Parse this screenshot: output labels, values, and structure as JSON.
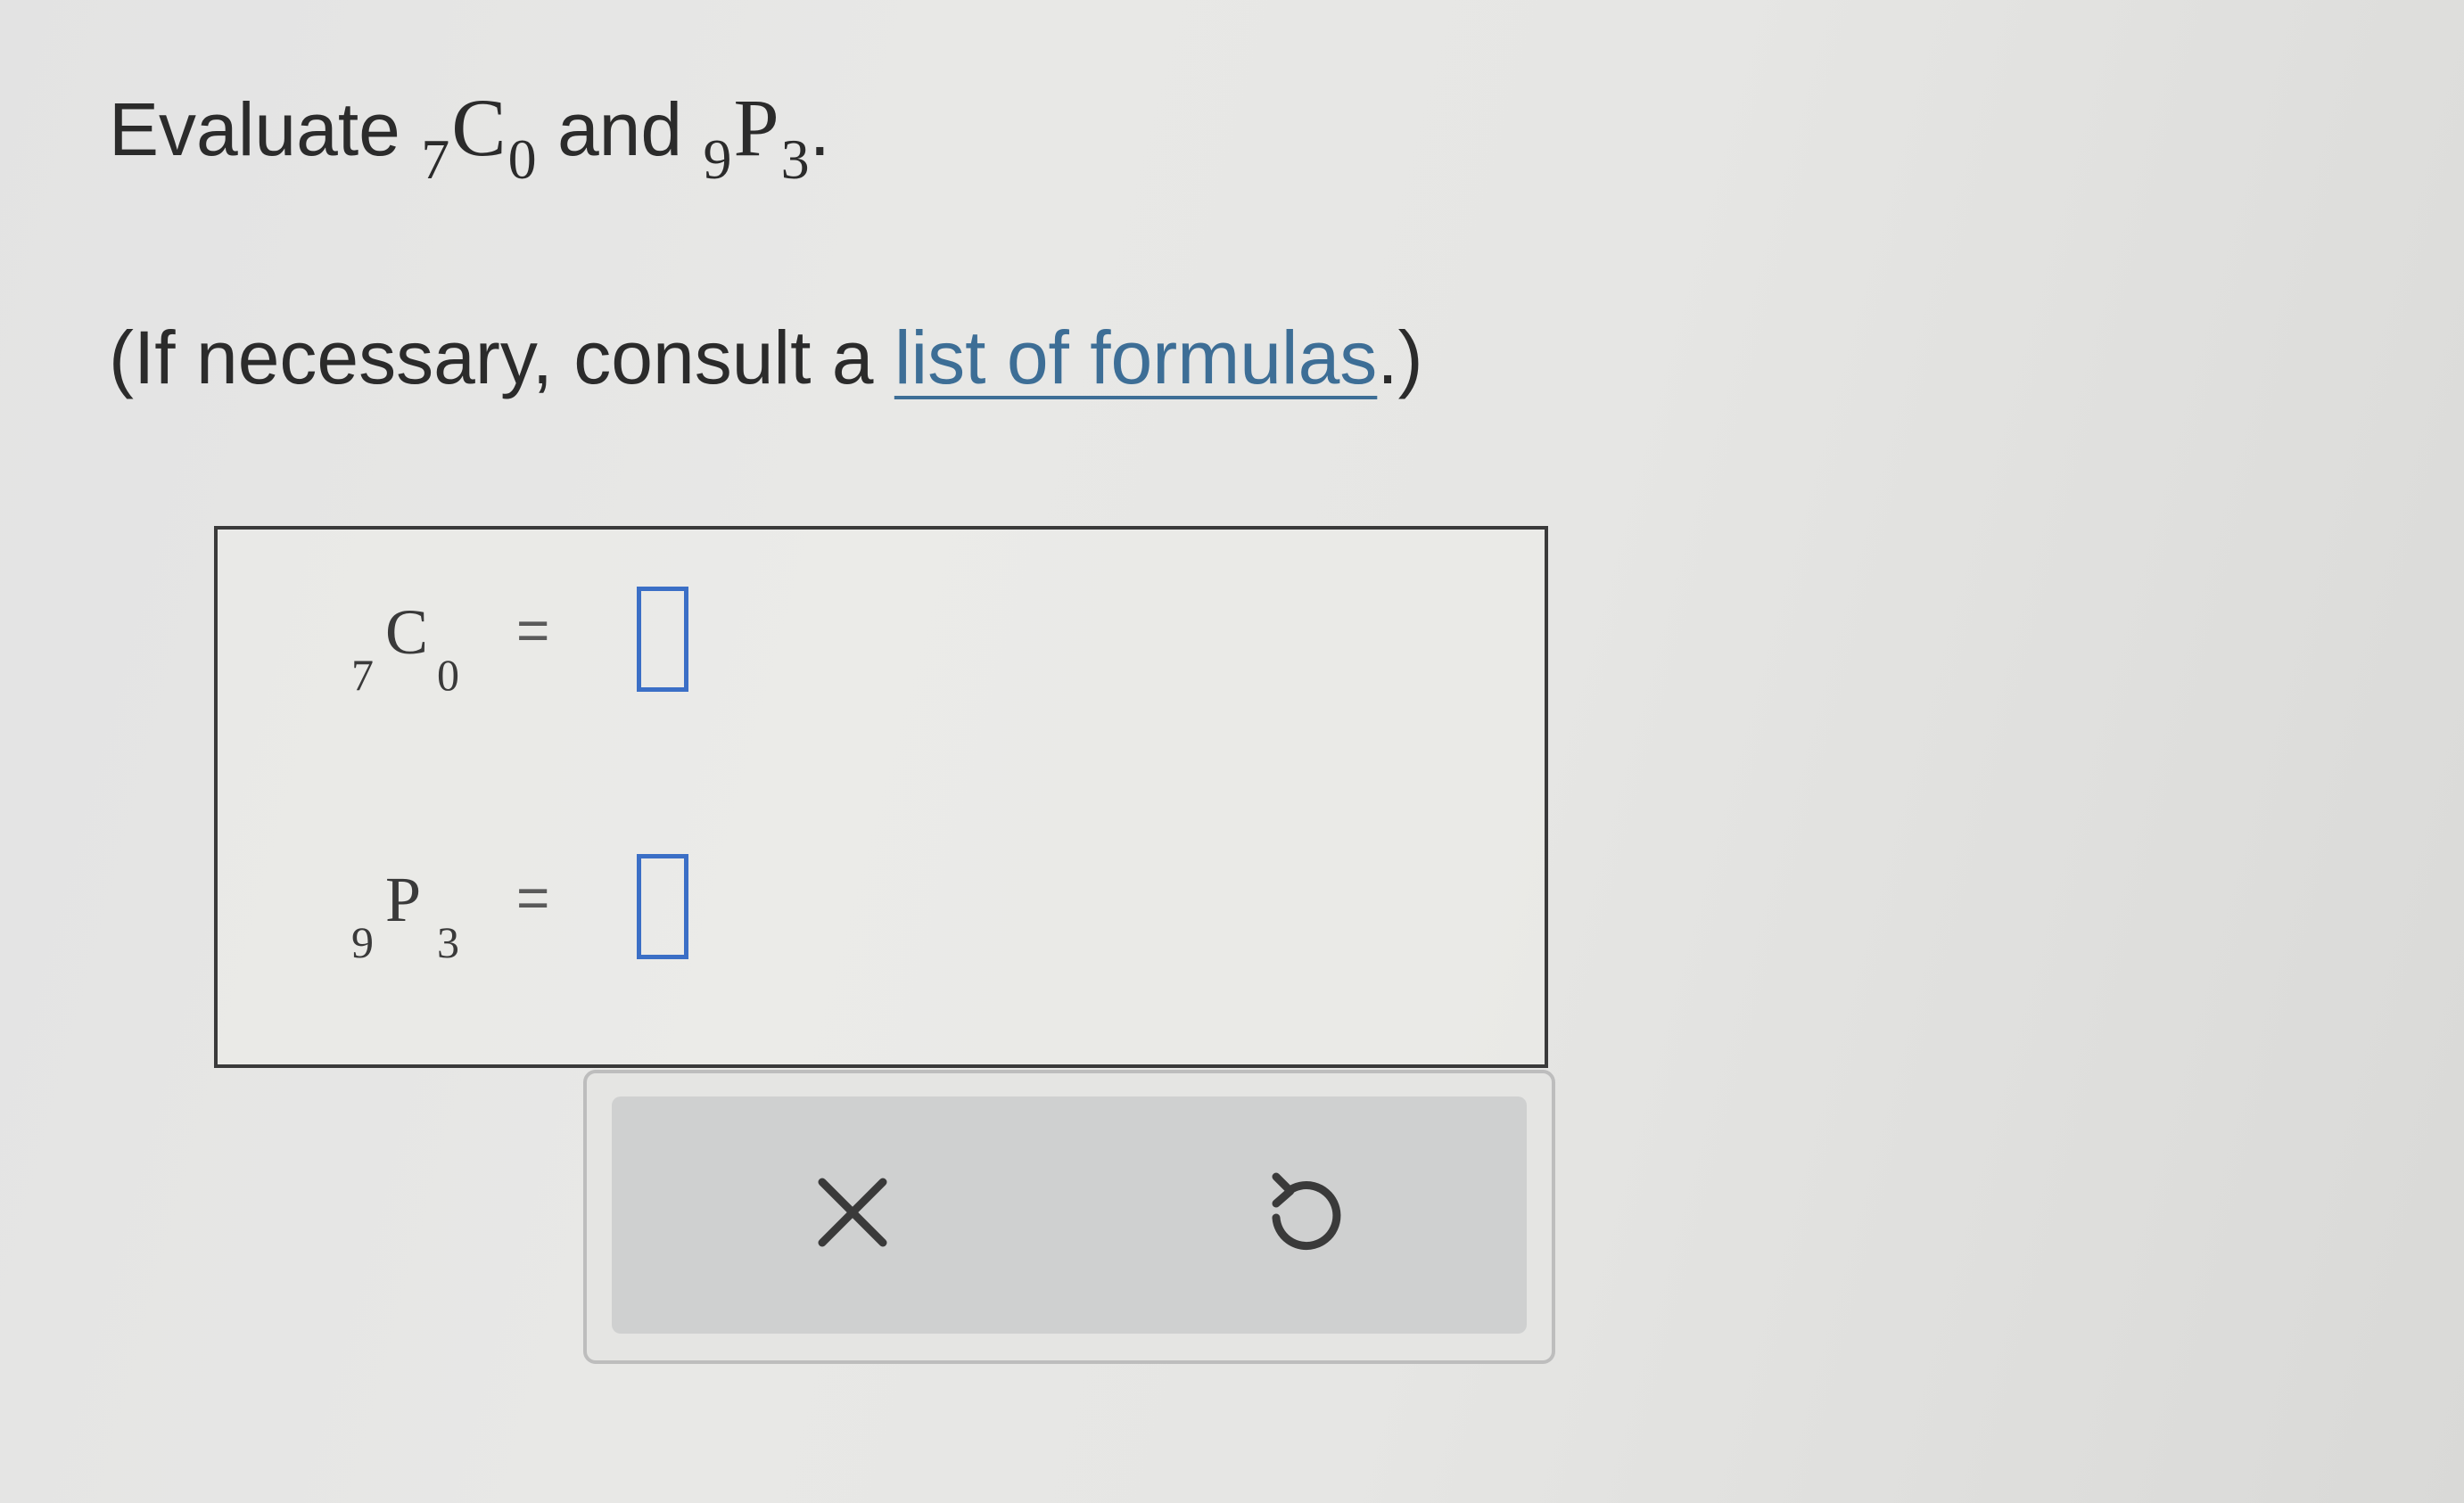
{
  "question": {
    "verb": "Evaluate",
    "term1": {
      "pre": "7",
      "main": "C",
      "post": "0"
    },
    "conjunction": "and",
    "term2": {
      "pre": "9",
      "main": "P",
      "post": "3"
    },
    "end": "."
  },
  "hint": {
    "before": "(If necessary, consult a ",
    "link": "list of formulas",
    "after": ".)"
  },
  "answers": [
    {
      "pre": "7",
      "main": "C",
      "post": "0",
      "equals": "="
    },
    {
      "pre": "9",
      "main": "P",
      "post": "3",
      "equals": "="
    }
  ],
  "toolbar": {
    "clear_icon": "close-icon",
    "undo_icon": "undo-icon"
  }
}
